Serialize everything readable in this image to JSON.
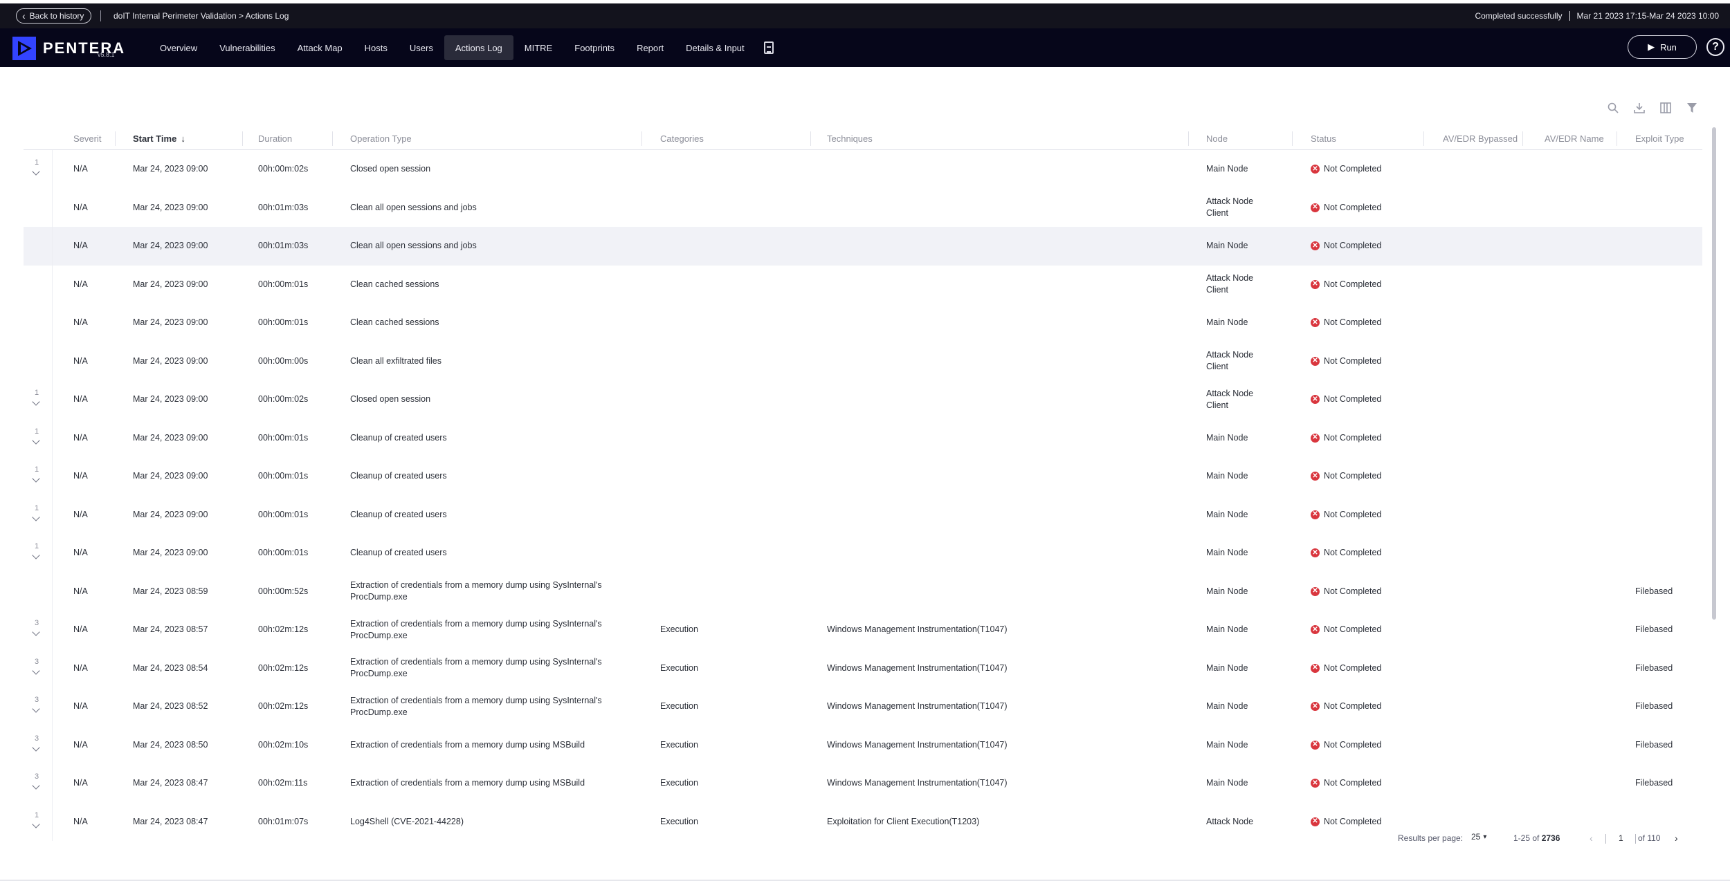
{
  "topbar": {
    "back_label": "Back to history",
    "breadcrumb": "doIT Internal Perimeter Validation > Actions Log",
    "status_text": "Completed successfully",
    "date_range": "Mar 21 2023 17:15-Mar 24 2023 10:00"
  },
  "brand": {
    "name": "PENTERA",
    "version": "v5.8.1",
    "accent": "#3344ff"
  },
  "nav": {
    "tabs": [
      {
        "label": "Overview"
      },
      {
        "label": "Vulnerabilities"
      },
      {
        "label": "Attack Map"
      },
      {
        "label": "Hosts"
      },
      {
        "label": "Users"
      },
      {
        "label": "Actions Log"
      },
      {
        "label": "MITRE"
      },
      {
        "label": "Footprints"
      },
      {
        "label": "Report"
      },
      {
        "label": "Details & Input"
      }
    ],
    "active_tab": "Actions Log",
    "run_label": "Run",
    "help_label": "?"
  },
  "toolbar": {
    "icons": [
      "search-icon",
      "download-icon",
      "columns-icon",
      "filter-icon"
    ]
  },
  "table": {
    "columns": [
      "Severit",
      "Start Time",
      "Duration",
      "Operation Type",
      "Categories",
      "Techniques",
      "Node",
      "Status",
      "AV/EDR Bypassed",
      "AV/EDR Name",
      "Exploit Type"
    ],
    "sort_column": "Start Time",
    "rows": [
      {
        "count": "1",
        "severity": "N/A",
        "start": "Mar 24, 2023 09:00",
        "duration": "00h:00m:02s",
        "op1": "Closed open session",
        "op2": "",
        "category": "",
        "technique": "",
        "node1": "Main Node",
        "node2": "",
        "status": "Not Completed",
        "exploit": ""
      },
      {
        "count": "",
        "severity": "N/A",
        "start": "Mar 24, 2023 09:00",
        "duration": "00h:01m:03s",
        "op1": "Clean all open sessions and jobs",
        "op2": "",
        "category": "",
        "technique": "",
        "node1": "Attack Node",
        "node2": "Client",
        "status": "Not Completed",
        "exploit": ""
      },
      {
        "count": "",
        "severity": "N/A",
        "start": "Mar 24, 2023 09:00",
        "duration": "00h:01m:03s",
        "op1": "Clean all open sessions and jobs",
        "op2": "",
        "category": "",
        "technique": "",
        "node1": "Main Node",
        "node2": "",
        "status": "Not Completed",
        "exploit": ""
      },
      {
        "count": "",
        "severity": "N/A",
        "start": "Mar 24, 2023 09:00",
        "duration": "00h:00m:01s",
        "op1": "Clean cached sessions",
        "op2": "",
        "category": "",
        "technique": "",
        "node1": "Attack Node",
        "node2": "Client",
        "status": "Not Completed",
        "exploit": ""
      },
      {
        "count": "",
        "severity": "N/A",
        "start": "Mar 24, 2023 09:00",
        "duration": "00h:00m:01s",
        "op1": "Clean cached sessions",
        "op2": "",
        "category": "",
        "technique": "",
        "node1": "Main Node",
        "node2": "",
        "status": "Not Completed",
        "exploit": ""
      },
      {
        "count": "",
        "severity": "N/A",
        "start": "Mar 24, 2023 09:00",
        "duration": "00h:00m:00s",
        "op1": "Clean all exfiltrated files",
        "op2": "",
        "category": "",
        "technique": "",
        "node1": "Attack Node",
        "node2": "Client",
        "status": "Not Completed",
        "exploit": ""
      },
      {
        "count": "1",
        "severity": "N/A",
        "start": "Mar 24, 2023 09:00",
        "duration": "00h:00m:02s",
        "op1": "Closed open session",
        "op2": "",
        "category": "",
        "technique": "",
        "node1": "Attack Node",
        "node2": "Client",
        "status": "Not Completed",
        "exploit": ""
      },
      {
        "count": "1",
        "severity": "N/A",
        "start": "Mar 24, 2023 09:00",
        "duration": "00h:00m:01s",
        "op1": "Cleanup of created users",
        "op2": "",
        "category": "",
        "technique": "",
        "node1": "Main Node",
        "node2": "",
        "status": "Not Completed",
        "exploit": ""
      },
      {
        "count": "1",
        "severity": "N/A",
        "start": "Mar 24, 2023 09:00",
        "duration": "00h:00m:01s",
        "op1": "Cleanup of created users",
        "op2": "",
        "category": "",
        "technique": "",
        "node1": "Main Node",
        "node2": "",
        "status": "Not Completed",
        "exploit": ""
      },
      {
        "count": "1",
        "severity": "N/A",
        "start": "Mar 24, 2023 09:00",
        "duration": "00h:00m:01s",
        "op1": "Cleanup of created users",
        "op2": "",
        "category": "",
        "technique": "",
        "node1": "Main Node",
        "node2": "",
        "status": "Not Completed",
        "exploit": ""
      },
      {
        "count": "1",
        "severity": "N/A",
        "start": "Mar 24, 2023 09:00",
        "duration": "00h:00m:01s",
        "op1": "Cleanup of created users",
        "op2": "",
        "category": "",
        "technique": "",
        "node1": "Main Node",
        "node2": "",
        "status": "Not Completed",
        "exploit": ""
      },
      {
        "count": "",
        "severity": "N/A",
        "start": "Mar 24, 2023 08:59",
        "duration": "00h:00m:52s",
        "op1": "Extraction of credentials from a memory dump using SysInternal's",
        "op2": "ProcDump.exe",
        "category": "",
        "technique": "",
        "node1": "Main Node",
        "node2": "",
        "status": "Not Completed",
        "exploit": "Filebased"
      },
      {
        "count": "3",
        "severity": "N/A",
        "start": "Mar 24, 2023 08:57",
        "duration": "00h:02m:12s",
        "op1": "Extraction of credentials from a memory dump using SysInternal's",
        "op2": "ProcDump.exe",
        "category": "Execution",
        "technique": "Windows Management Instrumentation(T1047)",
        "node1": "Main Node",
        "node2": "",
        "status": "Not Completed",
        "exploit": "Filebased"
      },
      {
        "count": "3",
        "severity": "N/A",
        "start": "Mar 24, 2023 08:54",
        "duration": "00h:02m:12s",
        "op1": "Extraction of credentials from a memory dump using SysInternal's",
        "op2": "ProcDump.exe",
        "category": "Execution",
        "technique": "Windows Management Instrumentation(T1047)",
        "node1": "Main Node",
        "node2": "",
        "status": "Not Completed",
        "exploit": "Filebased"
      },
      {
        "count": "3",
        "severity": "N/A",
        "start": "Mar 24, 2023 08:52",
        "duration": "00h:02m:12s",
        "op1": "Extraction of credentials from a memory dump using SysInternal's",
        "op2": "ProcDump.exe",
        "category": "Execution",
        "technique": "Windows Management Instrumentation(T1047)",
        "node1": "Main Node",
        "node2": "",
        "status": "Not Completed",
        "exploit": "Filebased"
      },
      {
        "count": "3",
        "severity": "N/A",
        "start": "Mar 24, 2023 08:50",
        "duration": "00h:02m:10s",
        "op1": "Extraction of credentials from a memory dump using MSBuild",
        "op2": "",
        "category": "Execution",
        "technique": "Windows Management Instrumentation(T1047)",
        "node1": "Main Node",
        "node2": "",
        "status": "Not Completed",
        "exploit": "Filebased"
      },
      {
        "count": "3",
        "severity": "N/A",
        "start": "Mar 24, 2023 08:47",
        "duration": "00h:02m:11s",
        "op1": "Extraction of credentials from a memory dump using MSBuild",
        "op2": "",
        "category": "Execution",
        "technique": "Windows Management Instrumentation(T1047)",
        "node1": "Main Node",
        "node2": "",
        "status": "Not Completed",
        "exploit": "Filebased"
      },
      {
        "count": "1",
        "severity": "N/A",
        "start": "Mar 24, 2023 08:47",
        "duration": "00h:01m:07s",
        "op1": "Log4Shell (CVE-2021-44228)",
        "op2": "",
        "category": "Execution",
        "technique": "Exploitation for Client Execution(T1203)",
        "node1": "Attack Node",
        "node2": "",
        "status": "Not Completed",
        "exploit": ""
      }
    ],
    "highlighted_row": 2,
    "status_color": "#d9363e"
  },
  "footer": {
    "results_per_page_label": "Results per page:",
    "results_per_page_value": "25",
    "range_label": "1-25 of",
    "total": "2736",
    "current_page": "1",
    "of_pages": "of 110"
  }
}
